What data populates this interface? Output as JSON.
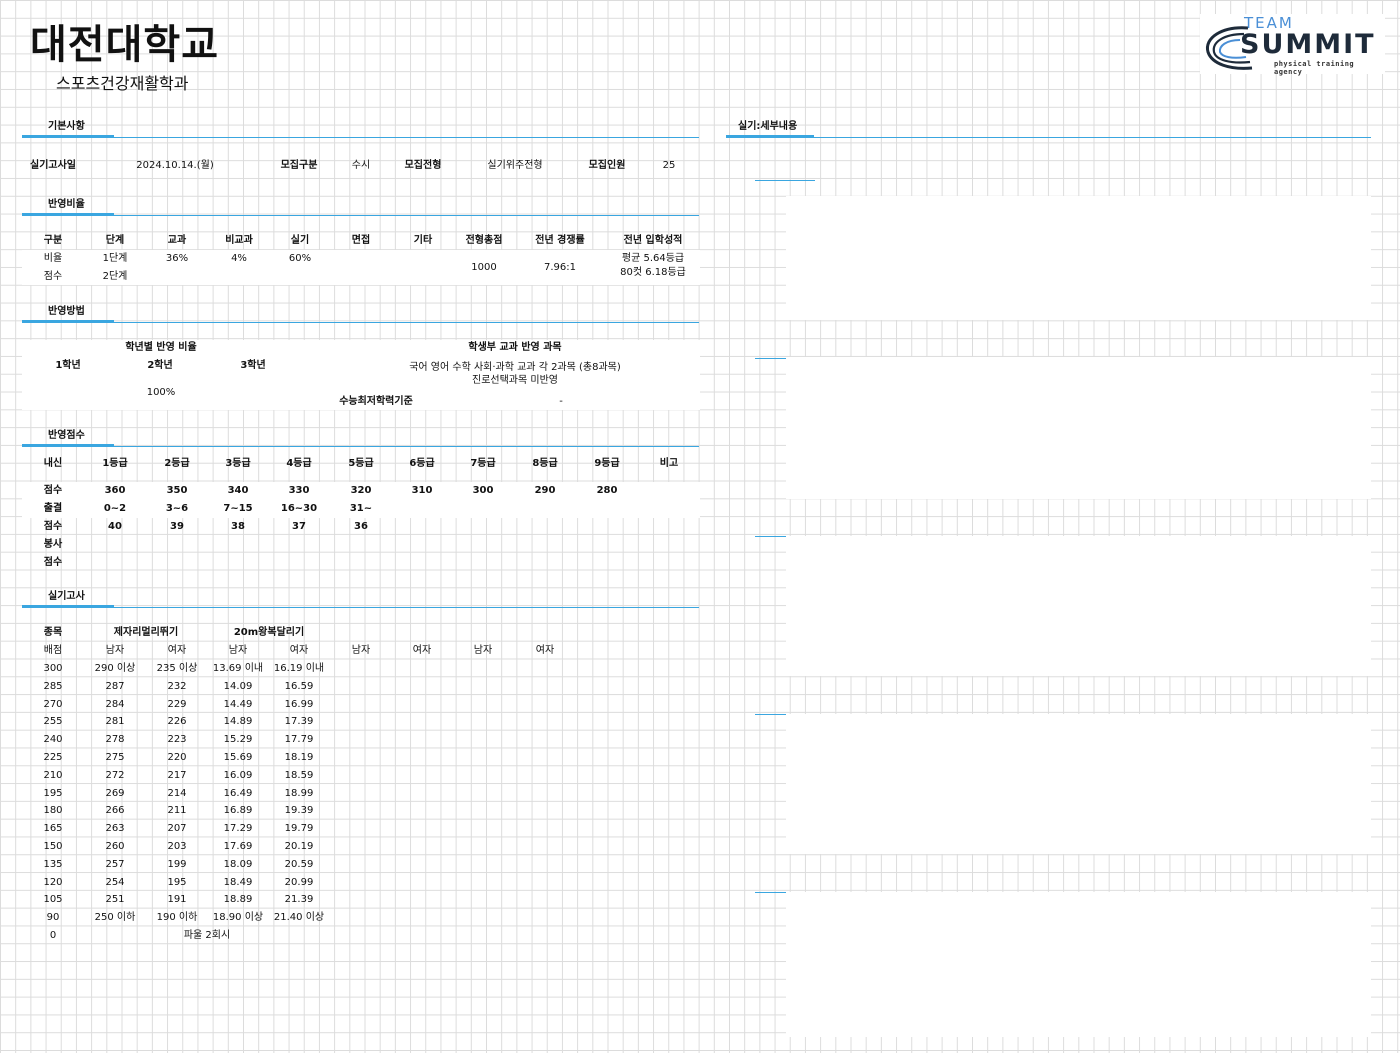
{
  "header": {
    "university": "대전대학교",
    "department": "스포츠건강재활학과",
    "logo": {
      "team": "TEAM",
      "summit": "SUMMIT",
      "agency": "physical training agency"
    }
  },
  "sections": {
    "basic": "기본사항",
    "ratio": "반영비율",
    "method": "반영방법",
    "score": "반영점수",
    "practical": "실기고사",
    "practical_detail": "실기:세부내용"
  },
  "basic_info": {
    "exam_date_label": "실기고사일",
    "exam_date": "2024.10.14.(월)",
    "type_label": "모집구분",
    "type": "수시",
    "track_label": "모집전형",
    "track": "실기위주전형",
    "quota_label": "모집인원",
    "quota": "25"
  },
  "ratio_table": {
    "headers": [
      "구분",
      "단계",
      "교과",
      "비교과",
      "실기",
      "면접",
      "기타",
      "전형총점",
      "전년 경쟁률",
      "전년 입학성적"
    ],
    "row1": [
      "비율",
      "1단계",
      "36%",
      "4%",
      "60%"
    ],
    "row2": [
      "점수",
      "2단계"
    ],
    "total": "1000",
    "competition": "7.96:1",
    "grade_avg": "평균 5.64등급",
    "grade_80": "80컷 6.18등급"
  },
  "method_table": {
    "grade_ratio_label": "학년별 반영 비율",
    "years": [
      "1학년",
      "2학년",
      "3학년"
    ],
    "ratio_value": "100%",
    "subjects_label": "학생부 교과 반영 과목",
    "subjects_line1": "국어 영어 수학 사회·과학 교과 각 2과목 (총8과목)",
    "subjects_line2": "진로선택과목 미반영",
    "csat_label": "수능최저학력기준",
    "csat_value": "-"
  },
  "score_table": {
    "headers": [
      "내신",
      "1등급",
      "2등급",
      "3등급",
      "4등급",
      "5등급",
      "6등급",
      "7등급",
      "8등급",
      "9등급",
      "비고"
    ],
    "score_row": [
      "점수",
      "360",
      "350",
      "340",
      "330",
      "320",
      "310",
      "300",
      "290",
      "280"
    ],
    "absence_row": [
      "출결",
      "0~2",
      "3~6",
      "7~15",
      "16~30",
      "31~"
    ],
    "absence_score_row": [
      "점수",
      "40",
      "39",
      "38",
      "37",
      "36"
    ],
    "volunteer_row": [
      "봉사"
    ],
    "volunteer_score_row": [
      "점수"
    ]
  },
  "practical_table": {
    "event_label": "종목",
    "event1": "제자리멀리뛰기",
    "event2": "20m왕복달리기",
    "points_label": "배점",
    "genders": [
      "남자",
      "여자",
      "남자",
      "여자",
      "남자",
      "여자",
      "남자",
      "여자"
    ],
    "rows": [
      [
        "300",
        "290 이상",
        "235 이상",
        "13.69 이내",
        "16.19 이내"
      ],
      [
        "285",
        "287",
        "232",
        "14.09",
        "16.59"
      ],
      [
        "270",
        "284",
        "229",
        "14.49",
        "16.99"
      ],
      [
        "255",
        "281",
        "226",
        "14.89",
        "17.39"
      ],
      [
        "240",
        "278",
        "223",
        "15.29",
        "17.79"
      ],
      [
        "225",
        "275",
        "220",
        "15.69",
        "18.19"
      ],
      [
        "210",
        "272",
        "217",
        "16.09",
        "18.59"
      ],
      [
        "195",
        "269",
        "214",
        "16.49",
        "18.99"
      ],
      [
        "180",
        "266",
        "211",
        "16.89",
        "19.39"
      ],
      [
        "165",
        "263",
        "207",
        "17.29",
        "19.79"
      ],
      [
        "150",
        "260",
        "203",
        "17.69",
        "20.19"
      ],
      [
        "135",
        "257",
        "199",
        "18.09",
        "20.59"
      ],
      [
        "120",
        "254",
        "195",
        "18.49",
        "20.99"
      ],
      [
        "105",
        "251",
        "191",
        "18.89",
        "21.39"
      ],
      [
        "90",
        "250 이하",
        "190 이하",
        "18.90 이상",
        "21.40 이상"
      ]
    ],
    "zero_label": "0",
    "zero_note": "파울 2회시"
  },
  "colors": {
    "accent_line": "#3aa6e0",
    "grid": "#dcdcdc"
  }
}
